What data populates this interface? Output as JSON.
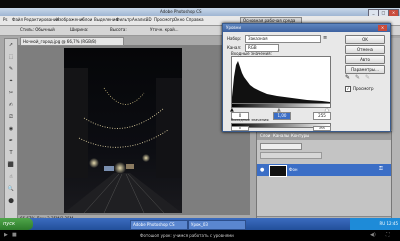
{
  "ps_window": {
    "title": "Adobe Photoshop CS",
    "controls": [
      "_",
      "□",
      "×"
    ]
  },
  "menubar": {
    "items": [
      "Файл",
      "Редактирование",
      "Изображение",
      "Слои",
      "Выделение",
      "Фильтр",
      "Анализ",
      "3D",
      "Просмотр",
      "Окно",
      "Справка"
    ],
    "workspace": "Основная рабочая среда"
  },
  "options": {
    "items": [
      "Стиль: Обычный",
      "Ширина:",
      "Высота:",
      "Уточн. край..."
    ]
  },
  "document": {
    "tab": "Ночной_город.jpg @ 66,7% (RGB/8)",
    "status": "66,67%   Док: 2,25M/2,25M"
  },
  "tools": [
    "➚",
    "⬚",
    "✎",
    "⌖",
    "✂",
    "✍",
    "⎚",
    "◉",
    "✒",
    "T",
    "⬛",
    "☝",
    "🔍",
    "⬤"
  ],
  "levels_dialog": {
    "title": "Уровни",
    "preset_label": "Набор:",
    "preset_value": "Заказная",
    "channel_label": "Канал:",
    "channel_value": "RGB",
    "input_label": "Входные значения:",
    "input_values": [
      "0",
      "1,00",
      "255"
    ],
    "output_label": "Выходные значения:",
    "output_values": [
      "0",
      "255"
    ],
    "buttons": [
      "OK",
      "Отмена",
      "Авто",
      "Параметры..."
    ],
    "preview_label": "Просмотр",
    "preview_checked": true
  },
  "layers_panel": {
    "tabs": [
      "Слои",
      "Каналы",
      "Контуры"
    ],
    "layer_name": "Фон"
  },
  "taskbar": {
    "start": "пуск",
    "tasks": [
      "Adobe Photoshop CS",
      "Урок_03"
    ],
    "tray": "RU  12:45"
  },
  "player": {
    "caption": "Фотошоп урок: учимся работать с уровнями"
  },
  "colors": {
    "titlebar": "#9fb6d2",
    "selection": "#3b6ec6",
    "taskbar": "#224f9a",
    "dialog_title": "#3d62a0"
  }
}
